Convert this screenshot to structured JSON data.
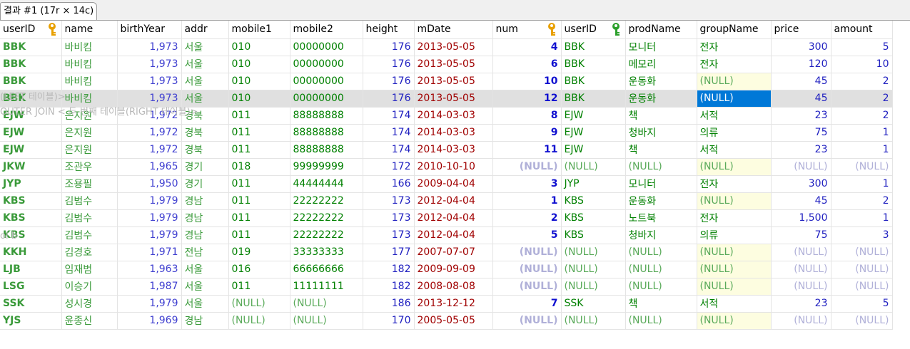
{
  "tab": {
    "title": "결과 #1 (17r × 14c)"
  },
  "columns": [
    "userID",
    "name",
    "birthYear",
    "addr",
    "mobile1",
    "mobile2",
    "height",
    "mDate",
    "num",
    "userID",
    "prodName",
    "groupName",
    "price",
    "amount"
  ],
  "colors": {
    "selection": "#0078d7",
    "key_gold": "#e8a000",
    "key_green": "#2ca02c"
  },
  "overlays": [
    "(LEFT 테이블)>",
    "OUTER JOIN < 두 번째 테이블(RIGHT 테이블)>",
    "ol b"
  ],
  "selected_row": 3,
  "rows": [
    [
      "BBK",
      "바비킴",
      "1,973",
      "서울",
      "010",
      "00000000",
      "176",
      "2013-05-05",
      "4",
      "BBK",
      "모니터",
      "전자",
      "300",
      "5"
    ],
    [
      "BBK",
      "바비킴",
      "1,973",
      "서울",
      "010",
      "00000000",
      "176",
      "2013-05-05",
      "6",
      "BBK",
      "메모리",
      "전자",
      "120",
      "10"
    ],
    [
      "BBK",
      "바비킴",
      "1,973",
      "서울",
      "010",
      "00000000",
      "176",
      "2013-05-05",
      "10",
      "BBK",
      "운동화",
      "(NULL)",
      "45",
      "2"
    ],
    [
      "BBK",
      "바비킴",
      "1,973",
      "서울",
      "010",
      "00000000",
      "176",
      "2013-05-05",
      "12",
      "BBK",
      "운동화",
      "(NULL)",
      "45",
      "2"
    ],
    [
      "EJW",
      "은지원",
      "1,972",
      "경북",
      "011",
      "88888888",
      "174",
      "2014-03-03",
      "8",
      "EJW",
      "책",
      "서적",
      "23",
      "2"
    ],
    [
      "EJW",
      "은지원",
      "1,972",
      "경북",
      "011",
      "88888888",
      "174",
      "2014-03-03",
      "9",
      "EJW",
      "청바지",
      "의류",
      "75",
      "1"
    ],
    [
      "EJW",
      "은지원",
      "1,972",
      "경북",
      "011",
      "88888888",
      "174",
      "2014-03-03",
      "11",
      "EJW",
      "책",
      "서적",
      "23",
      "1"
    ],
    [
      "JKW",
      "조관우",
      "1,965",
      "경기",
      "018",
      "99999999",
      "172",
      "2010-10-10",
      "(NULL)",
      "(NULL)",
      "(NULL)",
      "(NULL)",
      "(NULL)",
      "(NULL)"
    ],
    [
      "JYP",
      "조용필",
      "1,950",
      "경기",
      "011",
      "44444444",
      "166",
      "2009-04-04",
      "3",
      "JYP",
      "모니터",
      "전자",
      "300",
      "1"
    ],
    [
      "KBS",
      "김범수",
      "1,979",
      "경남",
      "011",
      "22222222",
      "173",
      "2012-04-04",
      "1",
      "KBS",
      "운동화",
      "(NULL)",
      "45",
      "2"
    ],
    [
      "KBS",
      "김범수",
      "1,979",
      "경남",
      "011",
      "22222222",
      "173",
      "2012-04-04",
      "2",
      "KBS",
      "노트북",
      "전자",
      "1,500",
      "1"
    ],
    [
      "KBS",
      "김범수",
      "1,979",
      "경남",
      "011",
      "22222222",
      "173",
      "2012-04-04",
      "5",
      "KBS",
      "청바지",
      "의류",
      "75",
      "3"
    ],
    [
      "KKH",
      "김경호",
      "1,971",
      "전남",
      "019",
      "33333333",
      "177",
      "2007-07-07",
      "(NULL)",
      "(NULL)",
      "(NULL)",
      "(NULL)",
      "(NULL)",
      "(NULL)"
    ],
    [
      "LJB",
      "임재범",
      "1,963",
      "서울",
      "016",
      "66666666",
      "182",
      "2009-09-09",
      "(NULL)",
      "(NULL)",
      "(NULL)",
      "(NULL)",
      "(NULL)",
      "(NULL)"
    ],
    [
      "LSG",
      "이승기",
      "1,987",
      "서울",
      "011",
      "11111111",
      "182",
      "2008-08-08",
      "(NULL)",
      "(NULL)",
      "(NULL)",
      "(NULL)",
      "(NULL)",
      "(NULL)"
    ],
    [
      "SSK",
      "성시경",
      "1,979",
      "서울",
      "(NULL)",
      "(NULL)",
      "186",
      "2013-12-12",
      "7",
      "SSK",
      "책",
      "서적",
      "23",
      "5"
    ],
    [
      "YJS",
      "윤종신",
      "1,969",
      "경남",
      "(NULL)",
      "(NULL)",
      "170",
      "2005-05-05",
      "(NULL)",
      "(NULL)",
      "(NULL)",
      "(NULL)",
      "(NULL)",
      "(NULL)"
    ]
  ]
}
